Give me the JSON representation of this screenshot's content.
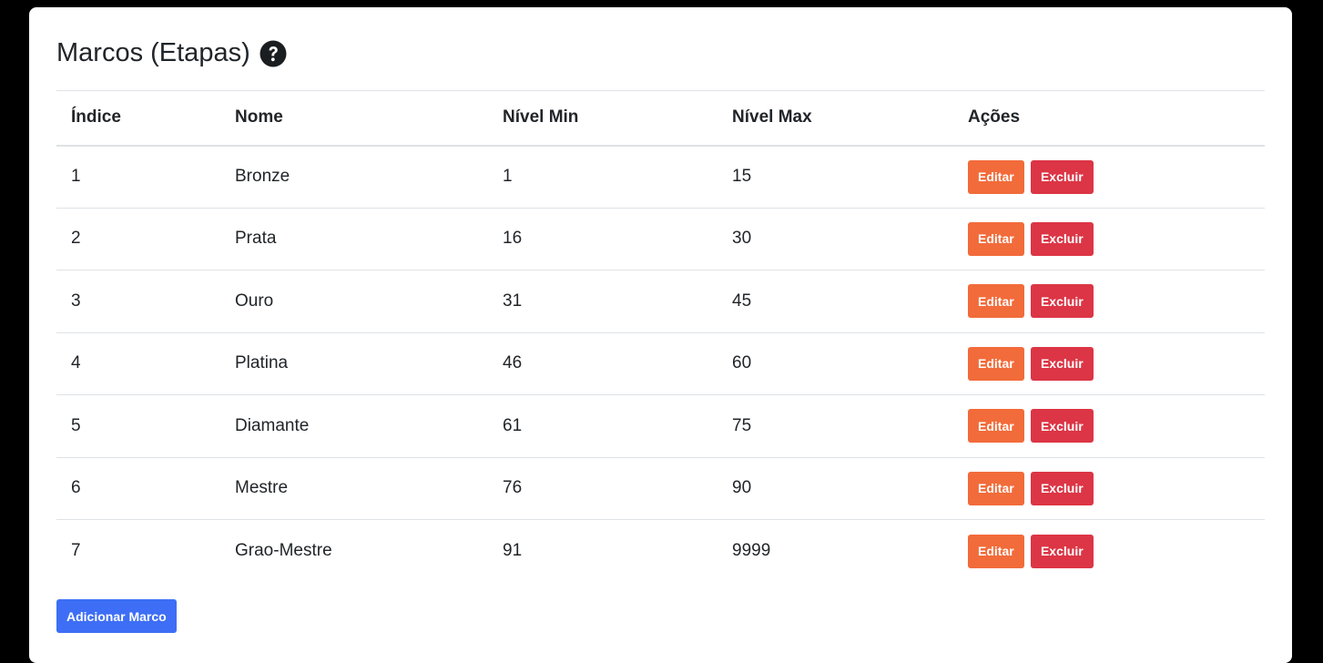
{
  "page": {
    "title": "Marcos (Etapas)",
    "help_icon": "question-circle-icon"
  },
  "table": {
    "headers": [
      "Índice",
      "Nome",
      "Nível Min",
      "Nível Max",
      "Ações"
    ],
    "rows": [
      {
        "index": "1",
        "name": "Bronze",
        "min": "1",
        "max": "15"
      },
      {
        "index": "2",
        "name": "Prata",
        "min": "16",
        "max": "30"
      },
      {
        "index": "3",
        "name": "Ouro",
        "min": "31",
        "max": "45"
      },
      {
        "index": "4",
        "name": "Platina",
        "min": "46",
        "max": "60"
      },
      {
        "index": "5",
        "name": "Diamante",
        "min": "61",
        "max": "75"
      },
      {
        "index": "6",
        "name": "Mestre",
        "min": "76",
        "max": "90"
      },
      {
        "index": "7",
        "name": "Grao-Mestre",
        "min": "91",
        "max": "9999"
      }
    ],
    "edit_label": "Editar",
    "delete_label": "Excluir"
  },
  "add_button_label": "Adicionar Marco",
  "colors": {
    "edit": "#f26b3a",
    "delete": "#dc3545",
    "add": "#3d6ef5"
  }
}
